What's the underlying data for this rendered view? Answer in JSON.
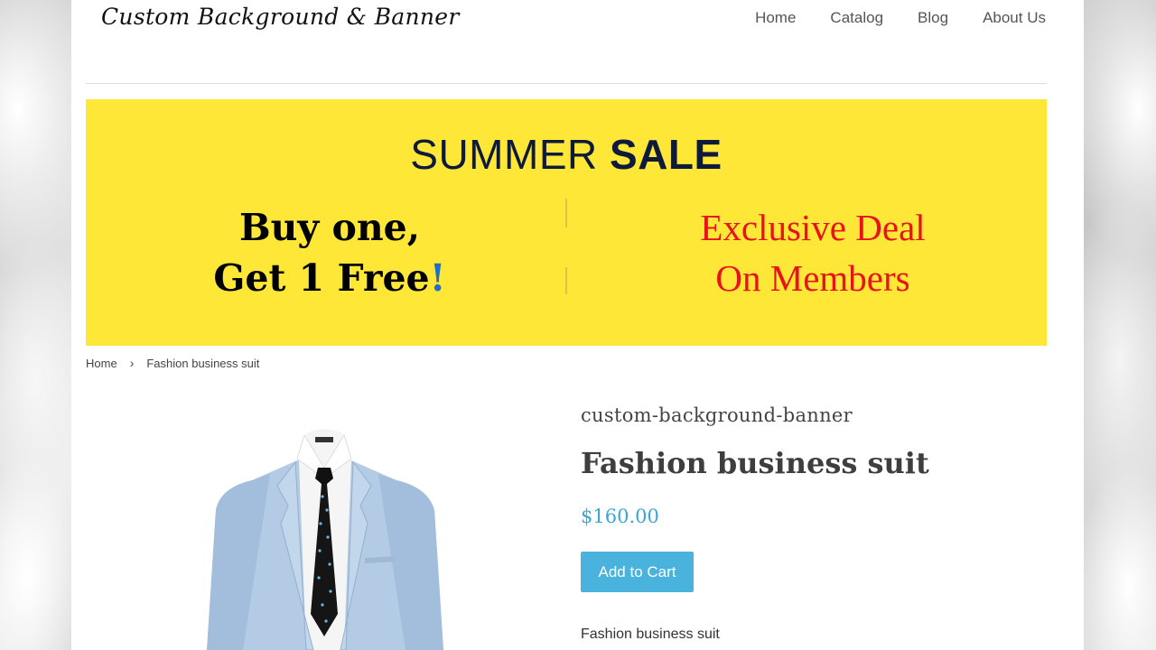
{
  "site": {
    "logo_text": "Custom Background & Banner"
  },
  "nav": {
    "items": [
      "Home",
      "Catalog",
      "Blog",
      "About Us"
    ]
  },
  "banner": {
    "headline_light": "SUMMER ",
    "headline_bold": "SALE",
    "left_line1": "Buy one,",
    "left_line2": "Get 1 Free",
    "left_bang": "!",
    "right_line1": "Exclusive Deal",
    "right_line2": "On Members",
    "bg_color": "#ffe737",
    "accent_red": "#e8121a"
  },
  "breadcrumb": {
    "home": "Home",
    "separator": "›",
    "current": "Fashion business suit"
  },
  "product": {
    "image_icon": "suit-jacket-image",
    "vendor": "custom-background-banner",
    "title": "Fashion business suit",
    "price": "$160.00",
    "add_to_cart": "Add to Cart",
    "description": "Fashion business suit",
    "price_color": "#3aa6d6",
    "button_color": "#49b2dd"
  }
}
